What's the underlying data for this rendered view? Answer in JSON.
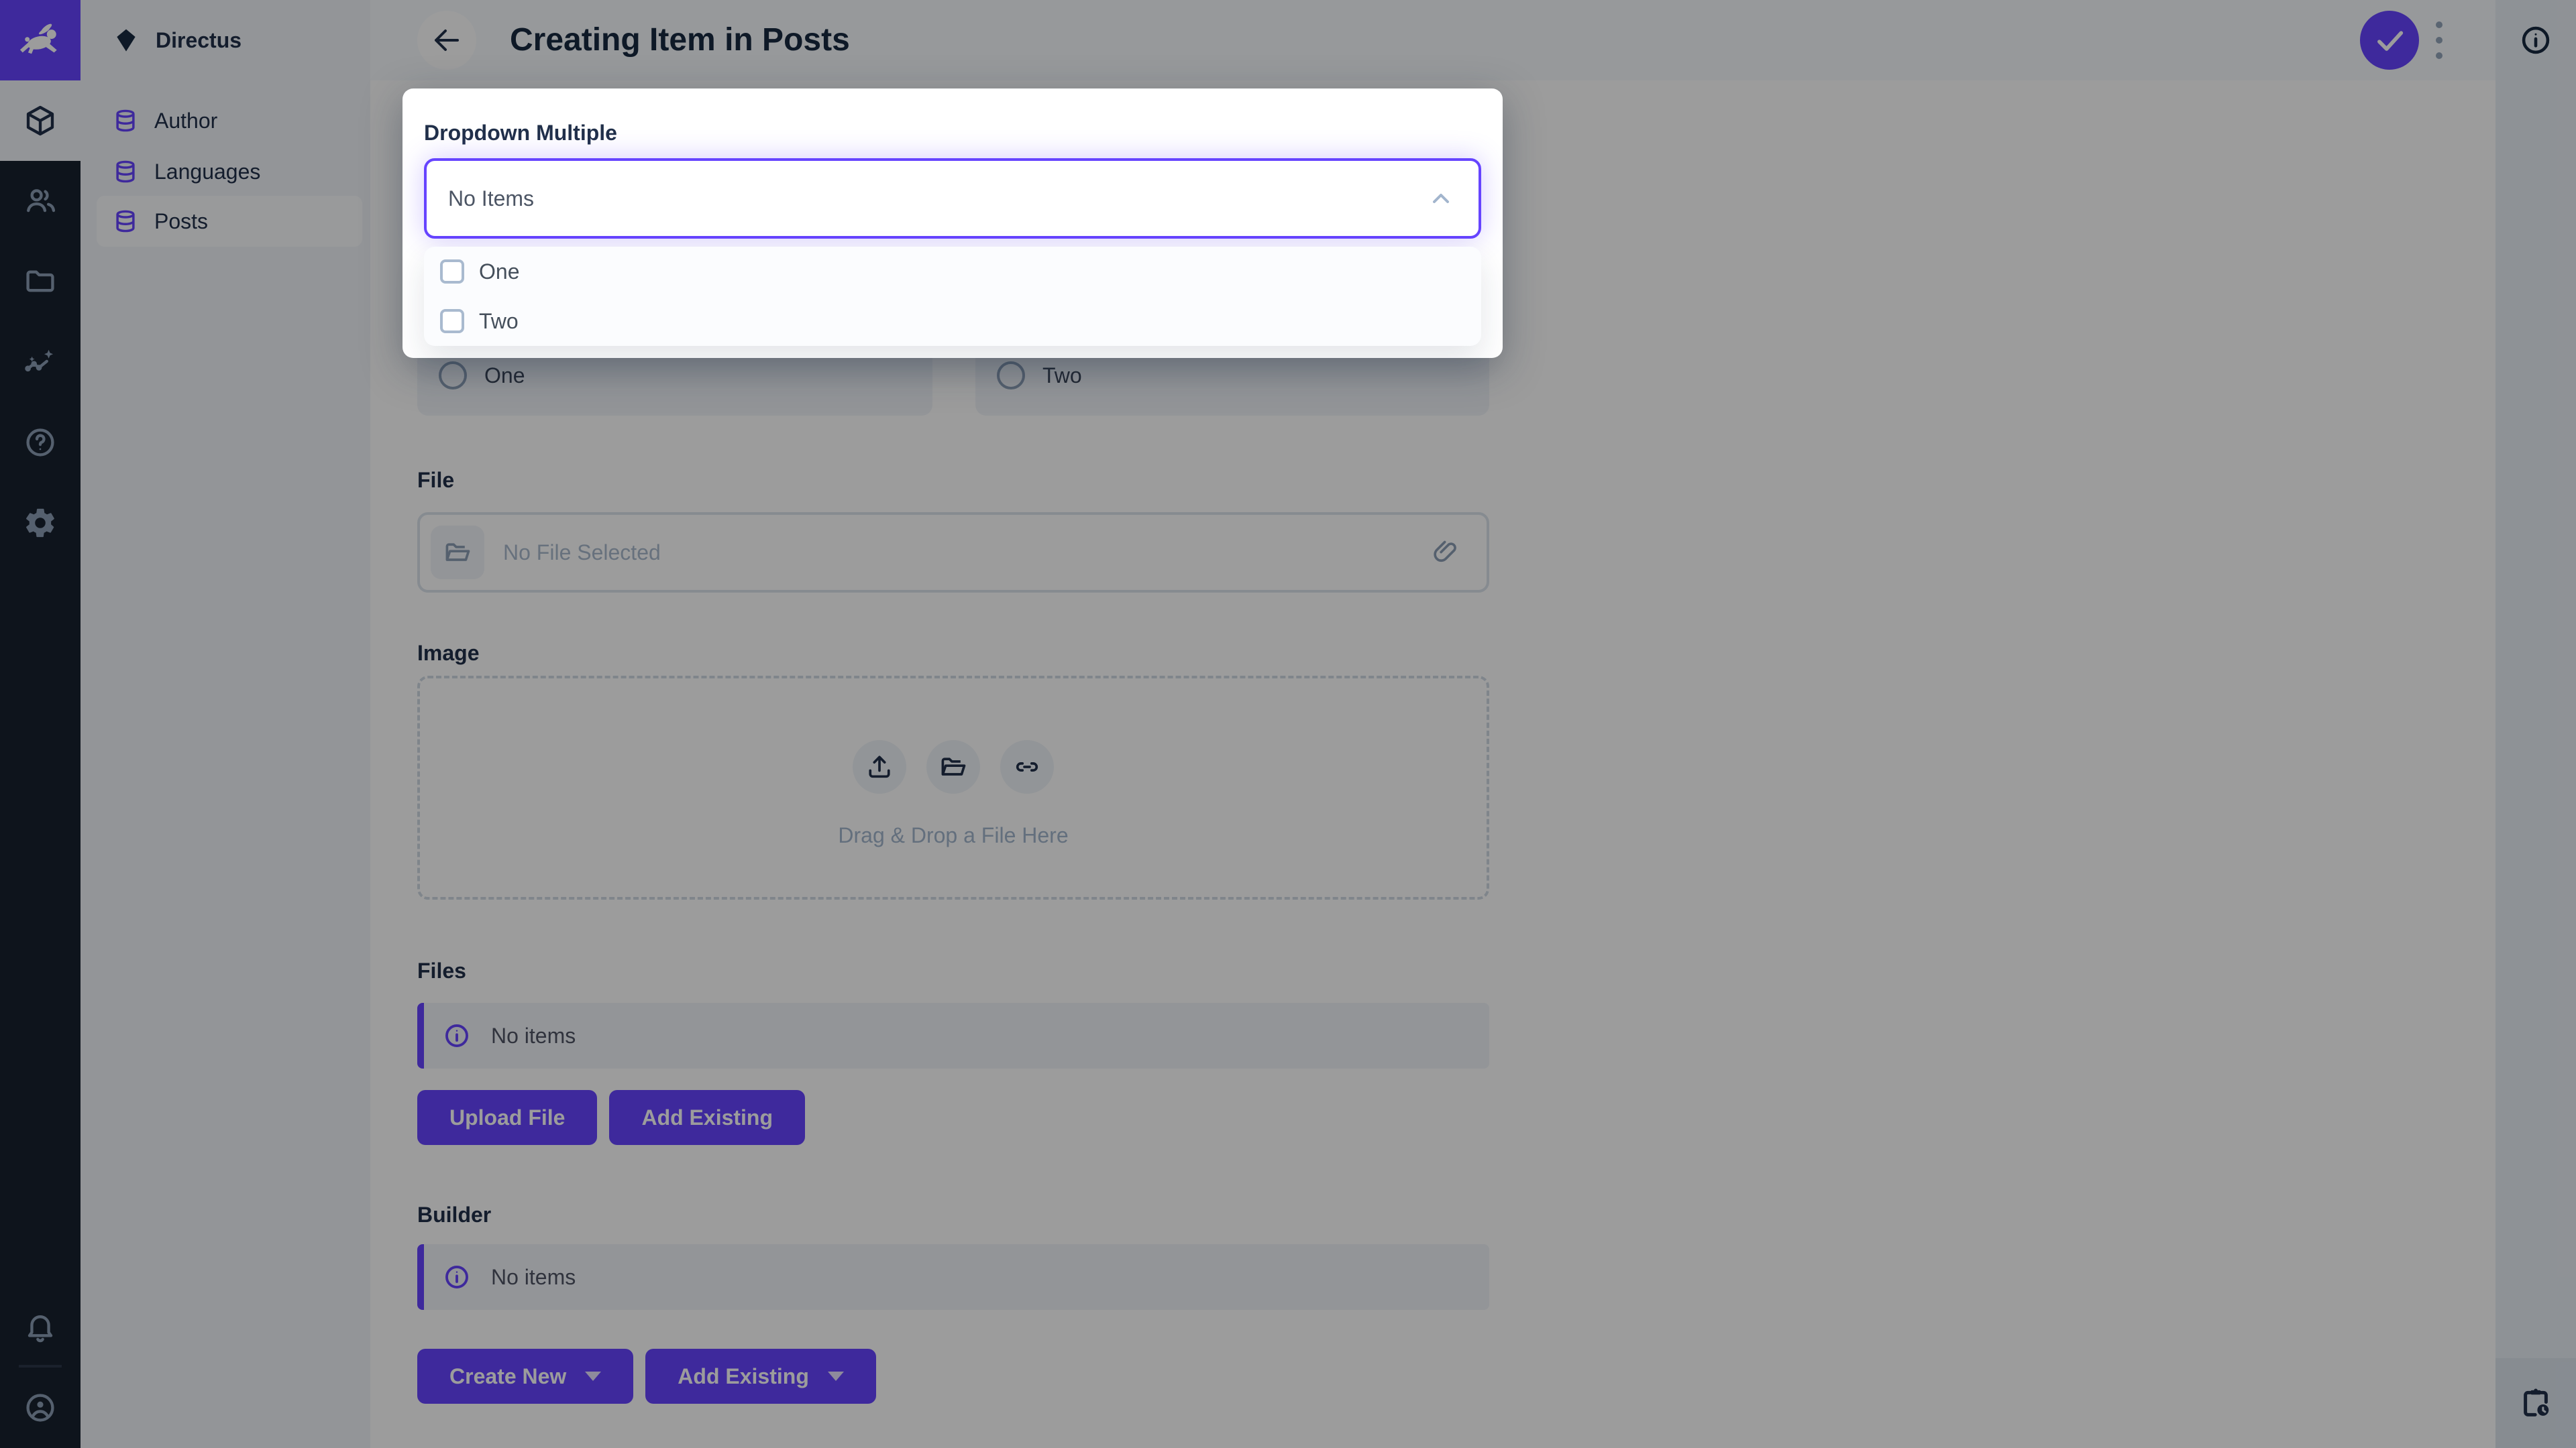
{
  "project": {
    "name": "Directus"
  },
  "header": {
    "title": "Creating Item in Posts"
  },
  "module_bar": {
    "icons": [
      "box-icon",
      "people-icon",
      "folder-icon",
      "insights-icon",
      "help-icon",
      "settings-icon",
      "bell-icon",
      "account-icon"
    ]
  },
  "nav": {
    "items": [
      {
        "label": "Author"
      },
      {
        "label": "Languages"
      },
      {
        "label": "Posts",
        "active": true
      }
    ]
  },
  "dropdown_modal": {
    "label": "Dropdown Multiple",
    "value": "No Items",
    "options": [
      {
        "label": "One"
      },
      {
        "label": "Two"
      }
    ]
  },
  "radio_field": {
    "options": [
      {
        "label": "One"
      },
      {
        "label": "Two"
      }
    ]
  },
  "file_field": {
    "label": "File",
    "placeholder": "No File Selected"
  },
  "image_field": {
    "label": "Image",
    "drop_text": "Drag & Drop a File Here"
  },
  "files_field": {
    "label": "Files",
    "notice": "No items",
    "buttons": [
      "Upload File",
      "Add Existing"
    ]
  },
  "builder_field": {
    "label": "Builder",
    "notice": "No items",
    "buttons": [
      "Create New",
      "Add Existing"
    ]
  },
  "colors": {
    "accent": "#6644FF",
    "module_bar_bg": "#18222F",
    "nav_bg": "#F0F4F9",
    "foreground": "#21304A",
    "subdued": "#A2B5CD",
    "overlay": "rgba(0,0,0,0.39)"
  }
}
